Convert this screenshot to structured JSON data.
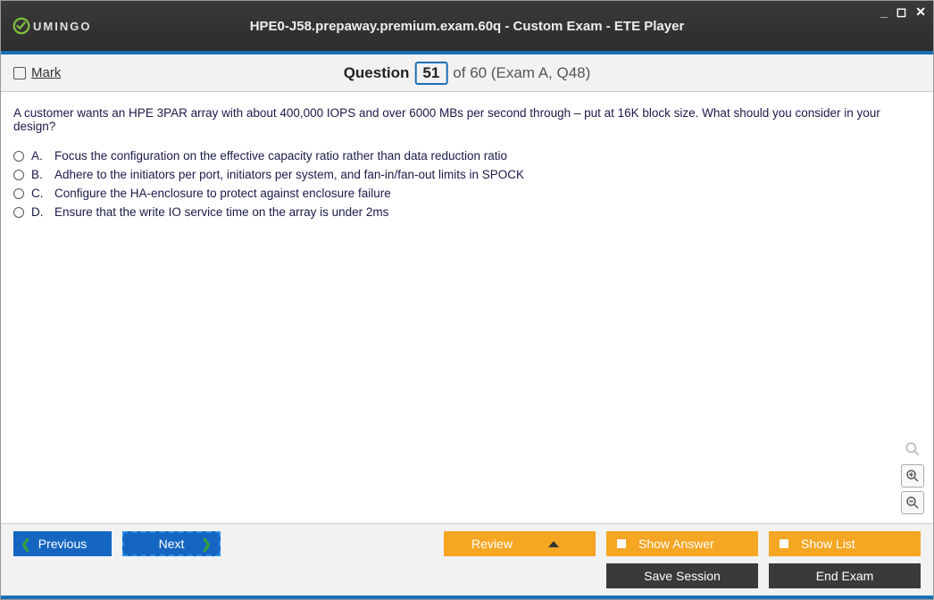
{
  "window": {
    "title": "HPE0-J58.prepaway.premium.exam.60q - Custom Exam - ETE Player",
    "logo_text": "UMINGO"
  },
  "question_bar": {
    "mark_label": "Mark",
    "q_label": "Question",
    "q_number": "51",
    "q_of": "of 60 (Exam A, Q48)"
  },
  "question": {
    "text": "A customer wants an HPE 3PAR array with about 400,000 IOPS and over 6000 MBs per second through – put at 16K block size. What should you consider in your design?",
    "answers": [
      {
        "letter": "A.",
        "text": "Focus the configuration on the effective capacity ratio rather than data reduction ratio"
      },
      {
        "letter": "B.",
        "text": "Adhere to the initiators per port, initiators per system, and fan-in/fan-out limits in SPOCK"
      },
      {
        "letter": "C.",
        "text": "Configure the HA-enclosure to protect against enclosure failure"
      },
      {
        "letter": "D.",
        "text": "Ensure that the write IO service time on the array is under 2ms"
      }
    ]
  },
  "footer": {
    "previous": "Previous",
    "next": "Next",
    "review": "Review",
    "show_answer": "Show Answer",
    "show_list": "Show List",
    "save_session": "Save Session",
    "end_exam": "End Exam"
  }
}
